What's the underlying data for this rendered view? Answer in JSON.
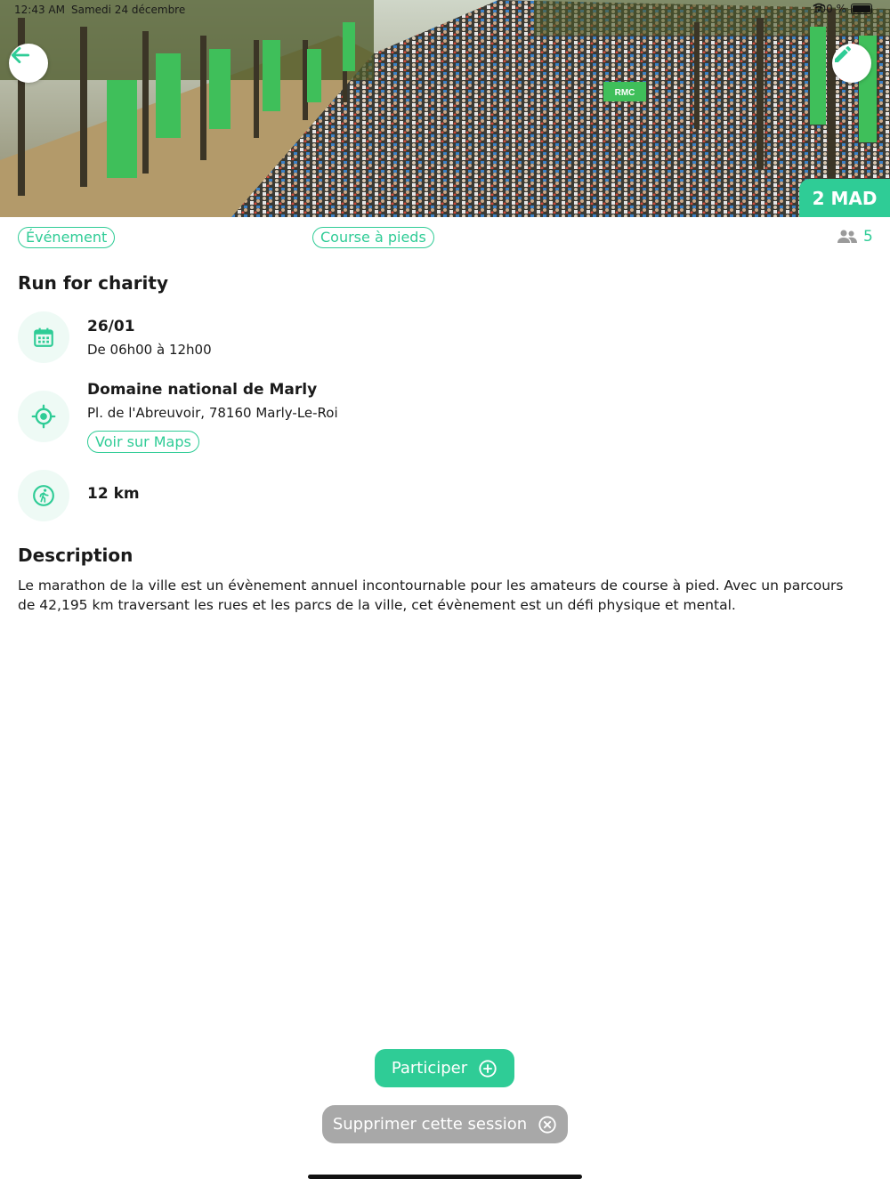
{
  "statusbar": {
    "time": "12:43 AM",
    "date": "Samedi 24 décembre",
    "battery": "100 %"
  },
  "header": {
    "back_icon": "arrow-left-icon",
    "edit_icon": "pencil-icon",
    "price": "2 MAD"
  },
  "tags": {
    "category": "Événement",
    "sport": "Course à pieds"
  },
  "participants": {
    "icon": "people-icon",
    "count": "5"
  },
  "event": {
    "title": "Run for charity",
    "date": "26/01",
    "time_range": "De 06h00 à 12h00",
    "location_name": "Domaine national de Marly",
    "address": "Pl. de l'Abreuvoir, 78160 Marly-Le-Roi",
    "maps_label": "Voir sur Maps",
    "distance": "12 km"
  },
  "description": {
    "title": "Description",
    "text": "Le marathon de la ville est un évènement annuel incontournable pour les amateurs de course à pied. Avec un parcours de 42,195 km traversant les rues et les parcs de la ville, cet évènement est un défi physique et mental."
  },
  "actions": {
    "participate_label": "Participer",
    "delete_label": "Supprimer cette session"
  },
  "colors": {
    "accent": "#2fcc96",
    "icon_bg": "#eefaf5",
    "delete_bg": "#a8a8a8"
  }
}
